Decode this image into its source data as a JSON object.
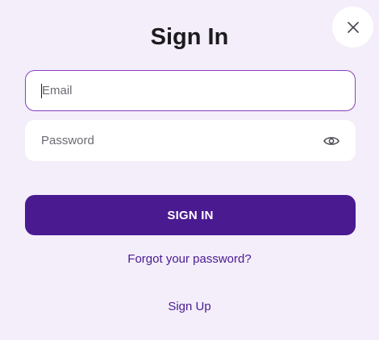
{
  "dialog": {
    "title": "Sign In",
    "close_icon": "close-icon"
  },
  "form": {
    "email": {
      "placeholder": "Email",
      "value": ""
    },
    "password": {
      "placeholder": "Password",
      "value": "",
      "toggle_icon": "eye-icon"
    },
    "submit_label": "SIGN IN",
    "forgot_label": "Forgot your password?",
    "signup_label": "Sign Up"
  },
  "colors": {
    "background": "#f3eef9",
    "primary": "#4a1a91",
    "focus_border": "#8c3fbf",
    "field_background": "#ffffff"
  }
}
